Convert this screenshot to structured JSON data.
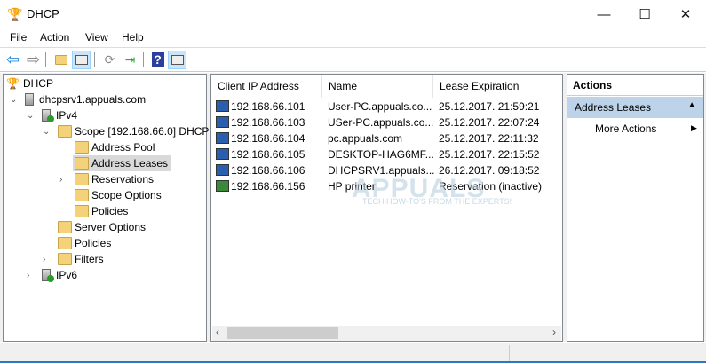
{
  "window": {
    "title": "DHCP",
    "minimize": "—",
    "maximize": "☐",
    "close": "✕"
  },
  "menu": [
    "File",
    "Action",
    "View",
    "Help"
  ],
  "toolbar": {
    "back": "⇦",
    "forward": "⇨",
    "help": "?"
  },
  "tree": [
    {
      "label": "DHCP",
      "level": 0
    },
    {
      "label": "dhcpsrv1.appuals.com",
      "level": 1,
      "expanded": true
    },
    {
      "label": "IPv4",
      "level": 2,
      "expanded": true
    },
    {
      "label": "Scope [192.168.66.0] DHCP",
      "level": 3,
      "expanded": true
    },
    {
      "label": "Address Pool",
      "level": 4
    },
    {
      "label": "Address Leases",
      "level": 4,
      "selected": true
    },
    {
      "label": "Reservations",
      "level": 4,
      "collapsed": true
    },
    {
      "label": "Scope Options",
      "level": 4
    },
    {
      "label": "Policies",
      "level": 4
    },
    {
      "label": "Server Options",
      "level": 3
    },
    {
      "label": "Policies",
      "level": 3
    },
    {
      "label": "Filters",
      "level": 3,
      "collapsed": true
    },
    {
      "label": "IPv6",
      "level": 2,
      "collapsed": true
    }
  ],
  "list": {
    "columns": [
      "Client IP Address",
      "Name",
      "Lease Expiration"
    ],
    "rows": [
      [
        "192.168.66.101",
        "User-PC.appuals.co...",
        "25.12.2017. 21:59:21"
      ],
      [
        "192.168.66.103",
        "USer-PC.appuals.co...",
        "25.12.2017. 22:07:24"
      ],
      [
        "192.168.66.104",
        "pc.appuals.com",
        "25.12.2017. 22:11:32"
      ],
      [
        "192.168.66.105",
        "DESKTOP-HAG6MF...",
        "25.12.2017. 22:15:52"
      ],
      [
        "192.168.66.106",
        "DHCPSRV1.appuals...",
        "26.12.2017. 09:18:52"
      ],
      [
        "192.168.66.156",
        "HP printer",
        "Reservation (inactive)"
      ]
    ]
  },
  "actions": {
    "header": "Actions",
    "section": "Address Leases",
    "more": "More Actions"
  },
  "watermark": {
    "brand": "APPUALS",
    "tagline": "TECH HOW-TO'S FROM THE EXPERTS!"
  }
}
